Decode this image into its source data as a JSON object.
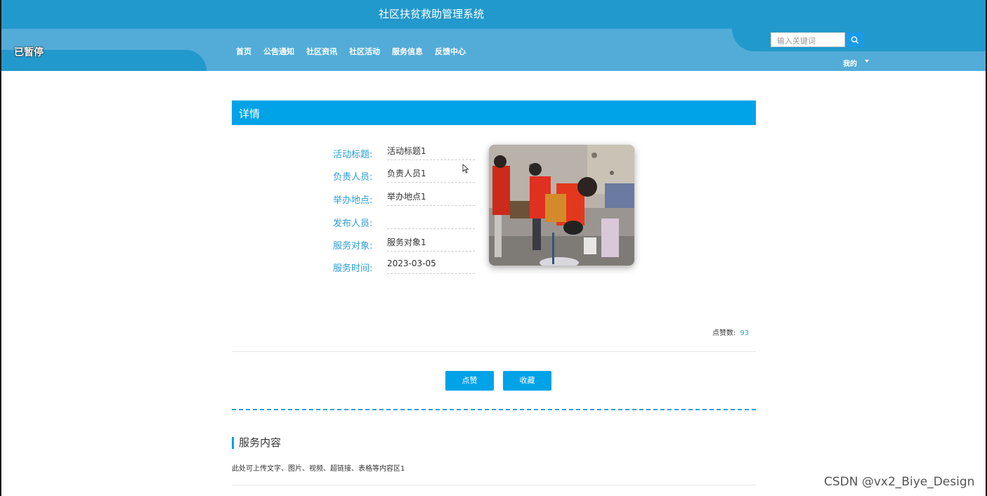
{
  "header": {
    "site_title": "社区扶贫救助管理系统",
    "paused_label": "已暂停",
    "nav": [
      "首页",
      "公告通知",
      "社区资讯",
      "社区活动",
      "服务信息",
      "反馈中心"
    ],
    "search_placeholder": "输入关键词",
    "user_menu": "我的"
  },
  "detail": {
    "heading": "详情",
    "fields": [
      {
        "label": "活动标题:",
        "value": "活动标题1"
      },
      {
        "label": "负责人员:",
        "value": "负责人员1"
      },
      {
        "label": "举办地点:",
        "value": "举办地点1"
      },
      {
        "label": "发布人员:",
        "value": ""
      },
      {
        "label": "服务对象:",
        "value": "服务对象1"
      },
      {
        "label": "服务时间:",
        "value": "2023-03-05"
      }
    ],
    "likes_label": "点赞数:",
    "likes_count": "93",
    "like_button": "点赞",
    "favorite_button": "收藏"
  },
  "content": {
    "heading": "服务内容",
    "text": "此处可上传文字、图片、视频、超链接、表格等内容区1"
  },
  "watermark": "CSDN @vx2_Biye_Design",
  "colors": {
    "header_dark": "#2299cc",
    "header_light": "#53acd8",
    "accent": "#00a2e8",
    "label": "#2a9fd6"
  }
}
